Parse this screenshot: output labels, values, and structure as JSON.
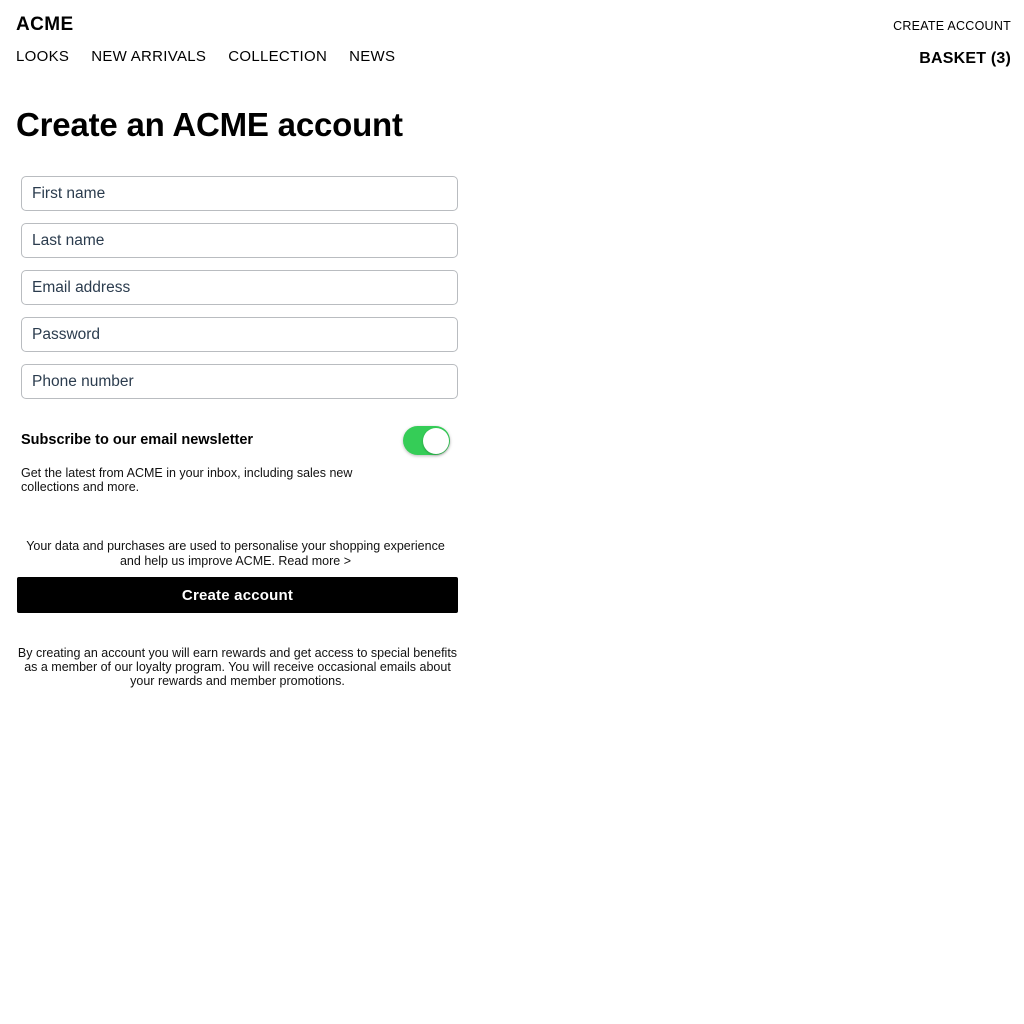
{
  "header": {
    "brand": "ACME",
    "nav": [
      {
        "label": "LOOKS"
      },
      {
        "label": "NEW ARRIVALS"
      },
      {
        "label": "COLLECTION"
      },
      {
        "label": "NEWS"
      }
    ],
    "create_account_label": "CREATE ACCOUNT",
    "basket_label": "BASKET (3)"
  },
  "main": {
    "title": "Create an ACME account",
    "form": {
      "fields": [
        {
          "name": "first-name",
          "placeholder": "First name",
          "value": "",
          "type": "text"
        },
        {
          "name": "last-name",
          "placeholder": "Last name",
          "value": "",
          "type": "text"
        },
        {
          "name": "email-address",
          "placeholder": "Email address",
          "value": "",
          "type": "email"
        },
        {
          "name": "password",
          "placeholder": "Password",
          "value": "",
          "type": "text"
        },
        {
          "name": "phone-number",
          "placeholder": "Phone number",
          "value": "",
          "type": "tel"
        }
      ]
    },
    "newsletter": {
      "title": "Subscribe to our email newsletter",
      "description": "Get the latest from ACME in your inbox, including sales new collections and more.",
      "toggle_state": "on",
      "toggle_on_color": "#35cd57",
      "toggle_knob_color": "#ffffff"
    },
    "privacy_note": "Your data and purchases are used to personalise your shopping experience and help us improve ACME. Read more >",
    "submit_label": "Create account",
    "disclaimer": "By creating an account you will earn rewards and get access to special benefits as a member of our loyalty program. You will receive occasional emails about your rewards and member promotions."
  },
  "theme": {
    "background": "#ffffff",
    "text": "#000000",
    "field_border": "#b9bcc0",
    "field_text": "#2b3c4e",
    "button_background": "#000000",
    "button_text": "#ffffff"
  }
}
